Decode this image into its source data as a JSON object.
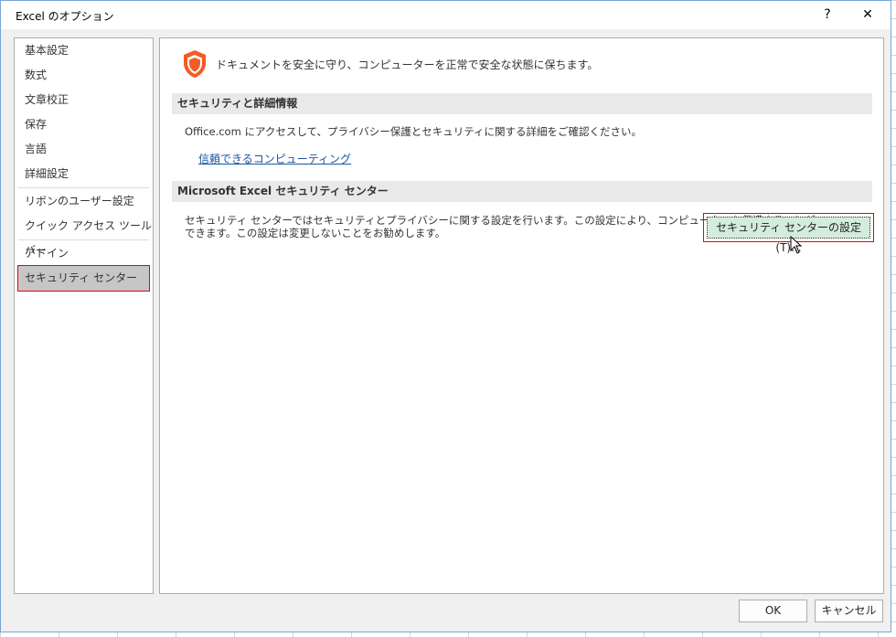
{
  "title": "Excel のオプション",
  "titlebar": {
    "help": "?",
    "close": "✕"
  },
  "nav": [
    "基本設定",
    "数式",
    "文章校正",
    "保存",
    "言語",
    "詳細設定",
    "リボンのユーザー設定",
    "クイック アクセス ツール バー",
    "アドイン",
    "セキュリティ センター"
  ],
  "header": "ドキュメントを安全に守り、コンピューターを正常で安全な状態に保ちます。",
  "sec1": {
    "title": "セキュリティと詳細情報",
    "text": "Office.com にアクセスして、プライバシー保護とセキュリティに関する詳細をご確認ください。",
    "link": "信頼できるコンピューティング"
  },
  "sec2": {
    "title": "Microsoft Excel セキュリティ センター",
    "text1": "セキュリティ センターではセキュリティとプライバシーに関する設定を行います。この設定により、コンピューターを保護することが",
    "text2": "できます。この設定は変更しないことをお勧めします。",
    "button": "セキュリティ センターの設定(T)..."
  },
  "footer": {
    "ok": "OK",
    "cancel": "キャンセル"
  },
  "colors": {
    "shield": "#f25c22",
    "selected_nav": "#c6c6c6",
    "highlight": "#ee0000",
    "button_bg": "#d4ecdc"
  }
}
